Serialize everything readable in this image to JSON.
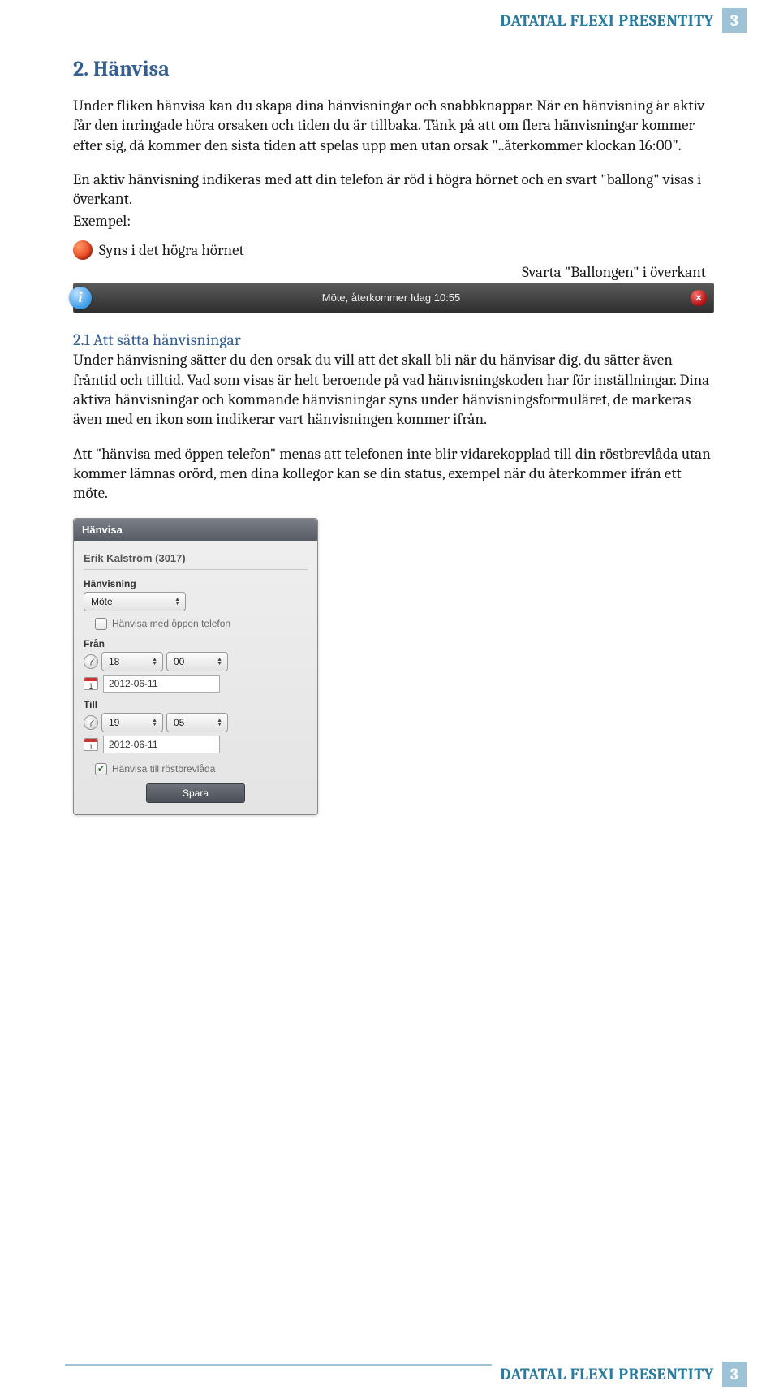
{
  "header": {
    "title": "DATATAL FLEXI PRESENTITY",
    "page_num": "3"
  },
  "section": {
    "number": "2.",
    "title": "Hänvisa",
    "para1": "Under fliken hänvisa kan du skapa dina hänvisningar och snabbknappar. När en hänvisning är aktiv får den inringade höra orsaken och tiden du är tillbaka. Tänk på att om flera hänvisningar kommer efter sig, då kommer den sista tiden att spelas upp men utan orsak \"..återkommer klockan 16:00\".",
    "para2": "En aktiv hänvisning indikeras med att din telefon är röd i högra hörnet och en svart \"ballong\" visas i överkant.",
    "example_label": "Exempel:",
    "corner_label": "Syns i det högra hörnet",
    "balloon_label": "Svarta \"Ballongen\" i överkant",
    "balloon_text": "Möte, återkommer Idag 10:55"
  },
  "subsection": {
    "number": "2.1",
    "title": "Att sätta hänvisningar",
    "para1": "Under hänvisning sätter du den orsak du vill att det skall bli när du hänvisar dig, du sätter även fråntid och tilltid. Vad som visas är helt beroende på vad hänvisningskoden har för inställningar. Dina aktiva hänvisningar och kommande hänvisningar syns under hänvisningsformuläret, de markeras även med en ikon som indikerar vart hänvisningen kommer ifrån.",
    "para2": "Att \"hänvisa med öppen telefon\" menas att telefonen inte blir vidarekopplad till din röstbrevlåda utan kommer lämnas orörd, men dina kollegor kan se din status, exempel när du återkommer ifrån ett möte."
  },
  "form": {
    "header": "Hänvisa",
    "user": "Erik Kalström (3017)",
    "hanvisning_label": "Hänvisning",
    "hanvisning_value": "Möte",
    "open_phone_label": "Hänvisa med öppen telefon",
    "from_label": "Från",
    "from_hour": "18",
    "from_min": "00",
    "from_date": "2012-06-11",
    "till_label": "Till",
    "till_hour": "19",
    "till_min": "05",
    "till_date": "2012-06-11",
    "voicemail_label": "Hänvisa till röstbrevlåda",
    "save_label": "Spara"
  },
  "footer": {
    "title": "DATATAL FLEXI PRESENTITY",
    "page_num": "3"
  }
}
